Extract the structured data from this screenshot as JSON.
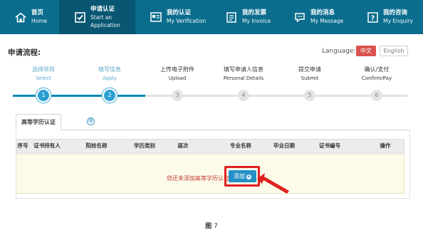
{
  "nav": {
    "items": [
      {
        "zh": "首页",
        "en": "Home",
        "icon": "home-icon"
      },
      {
        "zh": "申请认证",
        "en": "Start an Application",
        "icon": "checkbox-icon"
      },
      {
        "zh": "我的认证",
        "en": "My Verification",
        "icon": "certificate-icon"
      },
      {
        "zh": "我的发票",
        "en": "My Invoice",
        "icon": "invoice-icon"
      },
      {
        "zh": "我的消息",
        "en": "My Message",
        "icon": "message-icon"
      },
      {
        "zh": "我的咨询",
        "en": "My Enquiry",
        "icon": "question-icon"
      }
    ],
    "active_index": 1
  },
  "page": {
    "title": "申请流程:",
    "language_label": "Language:",
    "lang_zh": "中文",
    "lang_en": "English"
  },
  "steps": [
    {
      "zh": "选择项目",
      "en": "Select",
      "num": "1",
      "state": "done"
    },
    {
      "zh": "填写信息",
      "en": "Apply",
      "num": "2",
      "state": "current"
    },
    {
      "zh": "上传电子附件",
      "en": "Upload",
      "num": "3",
      "state": "todo"
    },
    {
      "zh": "填写申请人信息",
      "en": "Personal Details",
      "num": "4",
      "state": "todo"
    },
    {
      "zh": "提交申请",
      "en": "Submit",
      "num": "5",
      "state": "todo"
    },
    {
      "zh": "确认/支付",
      "en": "Confirm/Pay",
      "num": "6",
      "state": "todo"
    }
  ],
  "tabs": {
    "active": "高等学历认证",
    "add_symbol": "⊕"
  },
  "table": {
    "columns": [
      "序号",
      "证书持有人",
      "院校名称",
      "学历类别",
      "届次",
      "专业名称",
      "毕业日期",
      "证书编号",
      "操作"
    ],
    "empty_message": "您还未添加高等学历认证!",
    "add_button": "添加"
  },
  "caption": {
    "fig": "图",
    "num": "7"
  },
  "colors": {
    "nav_bg": "#0b6d8e",
    "nav_active": "#085672",
    "accent": "#2b9fd0",
    "highlight": "#e02020",
    "lang_active": "#d9534f"
  }
}
